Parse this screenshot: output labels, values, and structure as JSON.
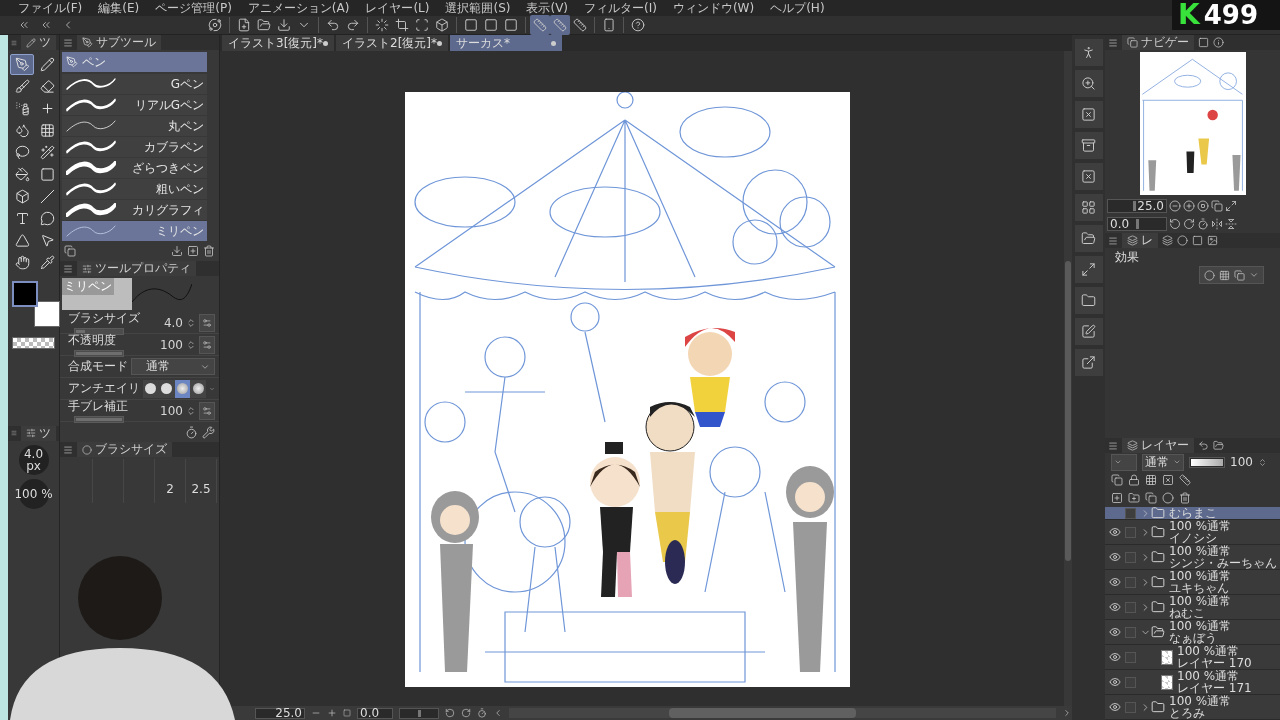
{
  "menu": [
    "ファイル(F)",
    "編集(E)",
    "ページ管理(P)",
    "アニメーション(A)",
    "レイヤー(L)",
    "選択範囲(S)",
    "表示(V)",
    "フィルター(I)",
    "ウィンドウ(W)",
    "ヘルプ(H)"
  ],
  "snap_toggles": [
    {
      "on": true
    },
    {
      "on": true
    },
    {
      "on": false
    }
  ],
  "document_tabs": [
    {
      "label": "イラスト3[復元]*",
      "selected": false
    },
    {
      "label": "イラスト2[復元]*",
      "selected": false
    },
    {
      "label": "サーカス*",
      "selected": true
    }
  ],
  "tool_palette": {
    "tab": "ツ",
    "tools": [
      {
        "selected": true
      },
      {
        "selected": false
      },
      {
        "selected": false
      },
      {
        "selected": false
      },
      {
        "selected": false
      },
      {
        "selected": false
      },
      {
        "selected": false
      },
      {
        "selected": false
      },
      {
        "selected": false
      },
      {
        "selected": false
      },
      {
        "selected": false
      },
      {
        "selected": false
      },
      {
        "selected": false
      },
      {
        "selected": false
      },
      {
        "selected": false
      },
      {
        "selected": false
      },
      {
        "selected": false
      },
      {
        "selected": false
      },
      {
        "selected": false
      },
      {
        "selected": false
      }
    ]
  },
  "color_swatches": [
    {
      "color": "#000000",
      "selected": true
    },
    {
      "color": "#ffffff",
      "selected": false
    }
  ],
  "subtool": {
    "tab": "サブツール",
    "group": "ペン",
    "items": [
      {
        "label": "Gペン",
        "selected": false
      },
      {
        "label": "リアルGペン",
        "selected": false
      },
      {
        "label": "丸ペン",
        "selected": false
      },
      {
        "label": "カブラペン",
        "selected": false
      },
      {
        "label": "ざらつきペン",
        "selected": false
      },
      {
        "label": "粗いペン",
        "selected": false
      },
      {
        "label": "カリグラフィ",
        "selected": false
      },
      {
        "label": "ミリペン",
        "selected": true
      }
    ]
  },
  "tool_property": {
    "tab": "ツールプロパティ",
    "preset": "ミリペン",
    "rows": [
      {
        "kind": "slider",
        "label": "ブラシサイズ",
        "value": "4.0",
        "level": 0.2
      },
      {
        "kind": "slider",
        "label": "不透明度",
        "value": "100",
        "level": 1
      },
      {
        "kind": "select",
        "label": "合成モード",
        "value": "通常"
      },
      {
        "kind": "shapes",
        "label": "アンチエイリ",
        "options": [
          {
            "selected": false
          },
          {
            "selected": false
          },
          {
            "selected": true
          },
          {
            "selected": false
          }
        ]
      },
      {
        "kind": "slider",
        "label": "手ブレ補正",
        "value": "100",
        "level": 1
      }
    ]
  },
  "size_strip": {
    "tab": "ツ",
    "size": "4.0",
    "unit": "px",
    "opacity": "100 %"
  },
  "brush_size_panel": {
    "tab": "ブラシサイズ",
    "values": [
      "2",
      "2.5"
    ]
  },
  "navigator": {
    "tab": "ナビゲー",
    "zoom": {
      "value": "25.0",
      "level": 0.45
    },
    "rotation": {
      "value": "0.0",
      "level": 0.5
    }
  },
  "layer_property": {
    "tab": "レ",
    "effect_label": "効果"
  },
  "layers": {
    "tab": "レイヤー",
    "blend": "通常",
    "opacity": {
      "value": "100",
      "level": 1
    },
    "items": [
      {
        "kind": "folder",
        "name": "むらまこ",
        "selected": true,
        "visible": false,
        "expanded": false
      },
      {
        "kind": "folder",
        "mode": "100 %通常",
        "name": "イノシシ",
        "selected": false,
        "visible": true,
        "expanded": false
      },
      {
        "kind": "folder",
        "mode": "100 %通常",
        "name": "シンジ・みーちゃん",
        "selected": false,
        "visible": true,
        "expanded": false
      },
      {
        "kind": "folder",
        "mode": "100 %通常",
        "name": "ユキちゃん",
        "selected": false,
        "visible": true,
        "expanded": false
      },
      {
        "kind": "folder",
        "mode": "100 %通常",
        "name": "ねむこ",
        "selected": false,
        "visible": true,
        "expanded": false
      },
      {
        "kind": "folder",
        "mode": "100 %通常",
        "name": "なぁぼう",
        "selected": false,
        "visible": true,
        "expanded": true,
        "children": [
          {
            "kind": "raster",
            "mode": "100 %通常",
            "name": "レイヤー 170",
            "selected": false,
            "visible": true
          },
          {
            "kind": "raster",
            "mode": "100 %通常",
            "name": "レイヤー 171",
            "selected": false,
            "visible": true
          }
        ]
      },
      {
        "kind": "folder",
        "mode": "100 %通常",
        "name": "とろみ",
        "selected": false,
        "visible": true,
        "expanded": false
      }
    ]
  },
  "status_bar": {
    "zoom": "25.0",
    "rotation": "0.0",
    "rotation_slider": {
      "level": 0.5
    }
  },
  "stream_counter": {
    "letter": "K",
    "value": "499"
  }
}
